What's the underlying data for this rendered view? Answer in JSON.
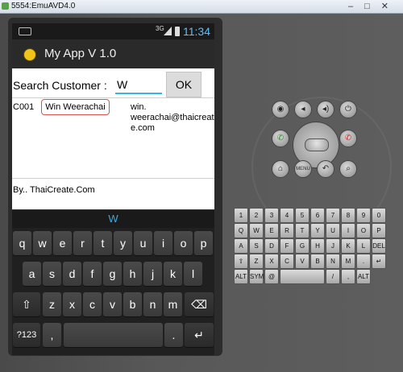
{
  "window": {
    "title": "5554:EmuAVD4.0"
  },
  "status_bar": {
    "network": "3G",
    "time": "11:34"
  },
  "app": {
    "title": "My App V 1.0"
  },
  "search": {
    "label": "Search Customer :",
    "value": "W",
    "ok_label": "OK"
  },
  "results": [
    {
      "id": "C001",
      "name": "Win Weerachai",
      "email": "win.\nweerachai@thaicreate.com"
    }
  ],
  "footer": {
    "text": "By.. ThaiCreate.Com"
  },
  "suggestion": "W",
  "keyboard": {
    "row1": [
      "q",
      "w",
      "e",
      "r",
      "t",
      "y",
      "u",
      "i",
      "o",
      "p"
    ],
    "row2": [
      "a",
      "s",
      "d",
      "f",
      "g",
      "h",
      "j",
      "k",
      "l"
    ],
    "row3": [
      "z",
      "x",
      "c",
      "v",
      "b",
      "n",
      "m"
    ],
    "num_label": "?123",
    "comma": ",",
    "period": "."
  },
  "hw_keyboard": {
    "row1": [
      "1",
      "2",
      "3",
      "4",
      "5",
      "6",
      "7",
      "8",
      "9",
      "0"
    ],
    "row2": [
      "Q",
      "W",
      "E",
      "R",
      "T",
      "Y",
      "U",
      "I",
      "O",
      "P"
    ],
    "row3": [
      "A",
      "S",
      "D",
      "F",
      "G",
      "H",
      "J",
      "K",
      "L",
      "DEL"
    ],
    "row4": [
      "⇧",
      "Z",
      "X",
      "C",
      "V",
      "B",
      "N",
      "M",
      ".",
      "↵"
    ],
    "row5": [
      "ALT",
      "SYM",
      "@",
      "",
      "",
      "/",
      ",",
      "ALT"
    ]
  },
  "hw_controls": {
    "top": [
      "camera-icon",
      "volume-down-icon",
      "volume-up-icon",
      "power-icon"
    ],
    "menu_label": "MENU"
  }
}
